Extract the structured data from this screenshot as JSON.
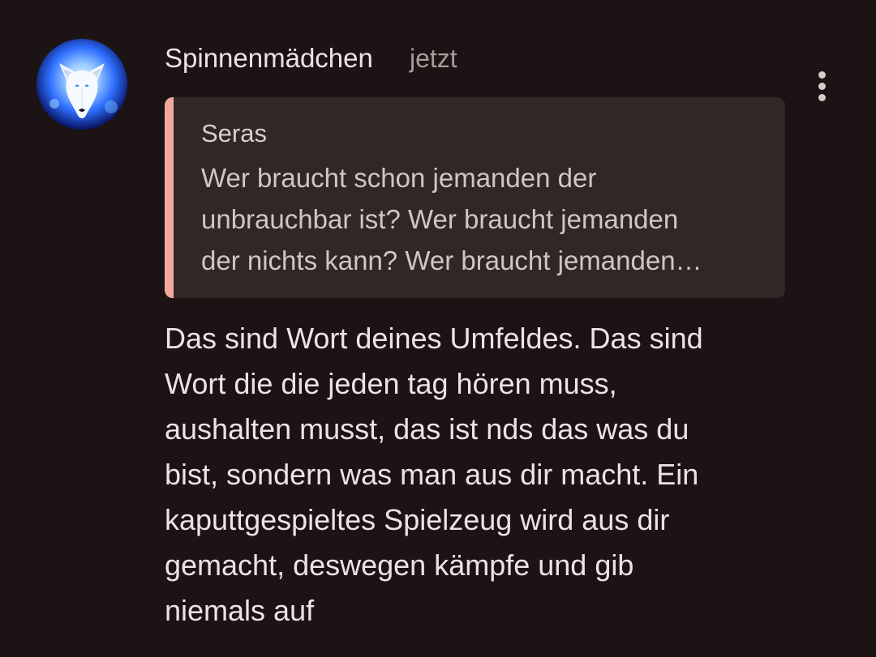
{
  "comment": {
    "author": "Spinnenmädchen",
    "timestamp": "jetzt",
    "avatar_icon": "white-wolf-avatar",
    "menu_icon": "more-vertical-icon",
    "quote": {
      "author": "Seras",
      "text": "Wer braucht schon jemanden der\nunbrauchbar ist? Wer braucht jemanden\nder nichts kann? Wer braucht jemanden…"
    },
    "body": "Das sind Wort deines Umfeldes. Das sind\nWort die die jeden tag hören muss,\naushalten musst, das ist nds das was du\nbist, sondern was man aus dir macht. Ein\nkaputtgespieltes Spielzeug wird aus dir\ngemacht, deswegen kämpfe und gib\nniemals auf"
  },
  "colors": {
    "background": "#1c1414",
    "quote_background": "#2f2827",
    "quote_accent": "#f2a89c",
    "text_primary": "#ece4e4",
    "text_secondary": "#a79c9c"
  }
}
